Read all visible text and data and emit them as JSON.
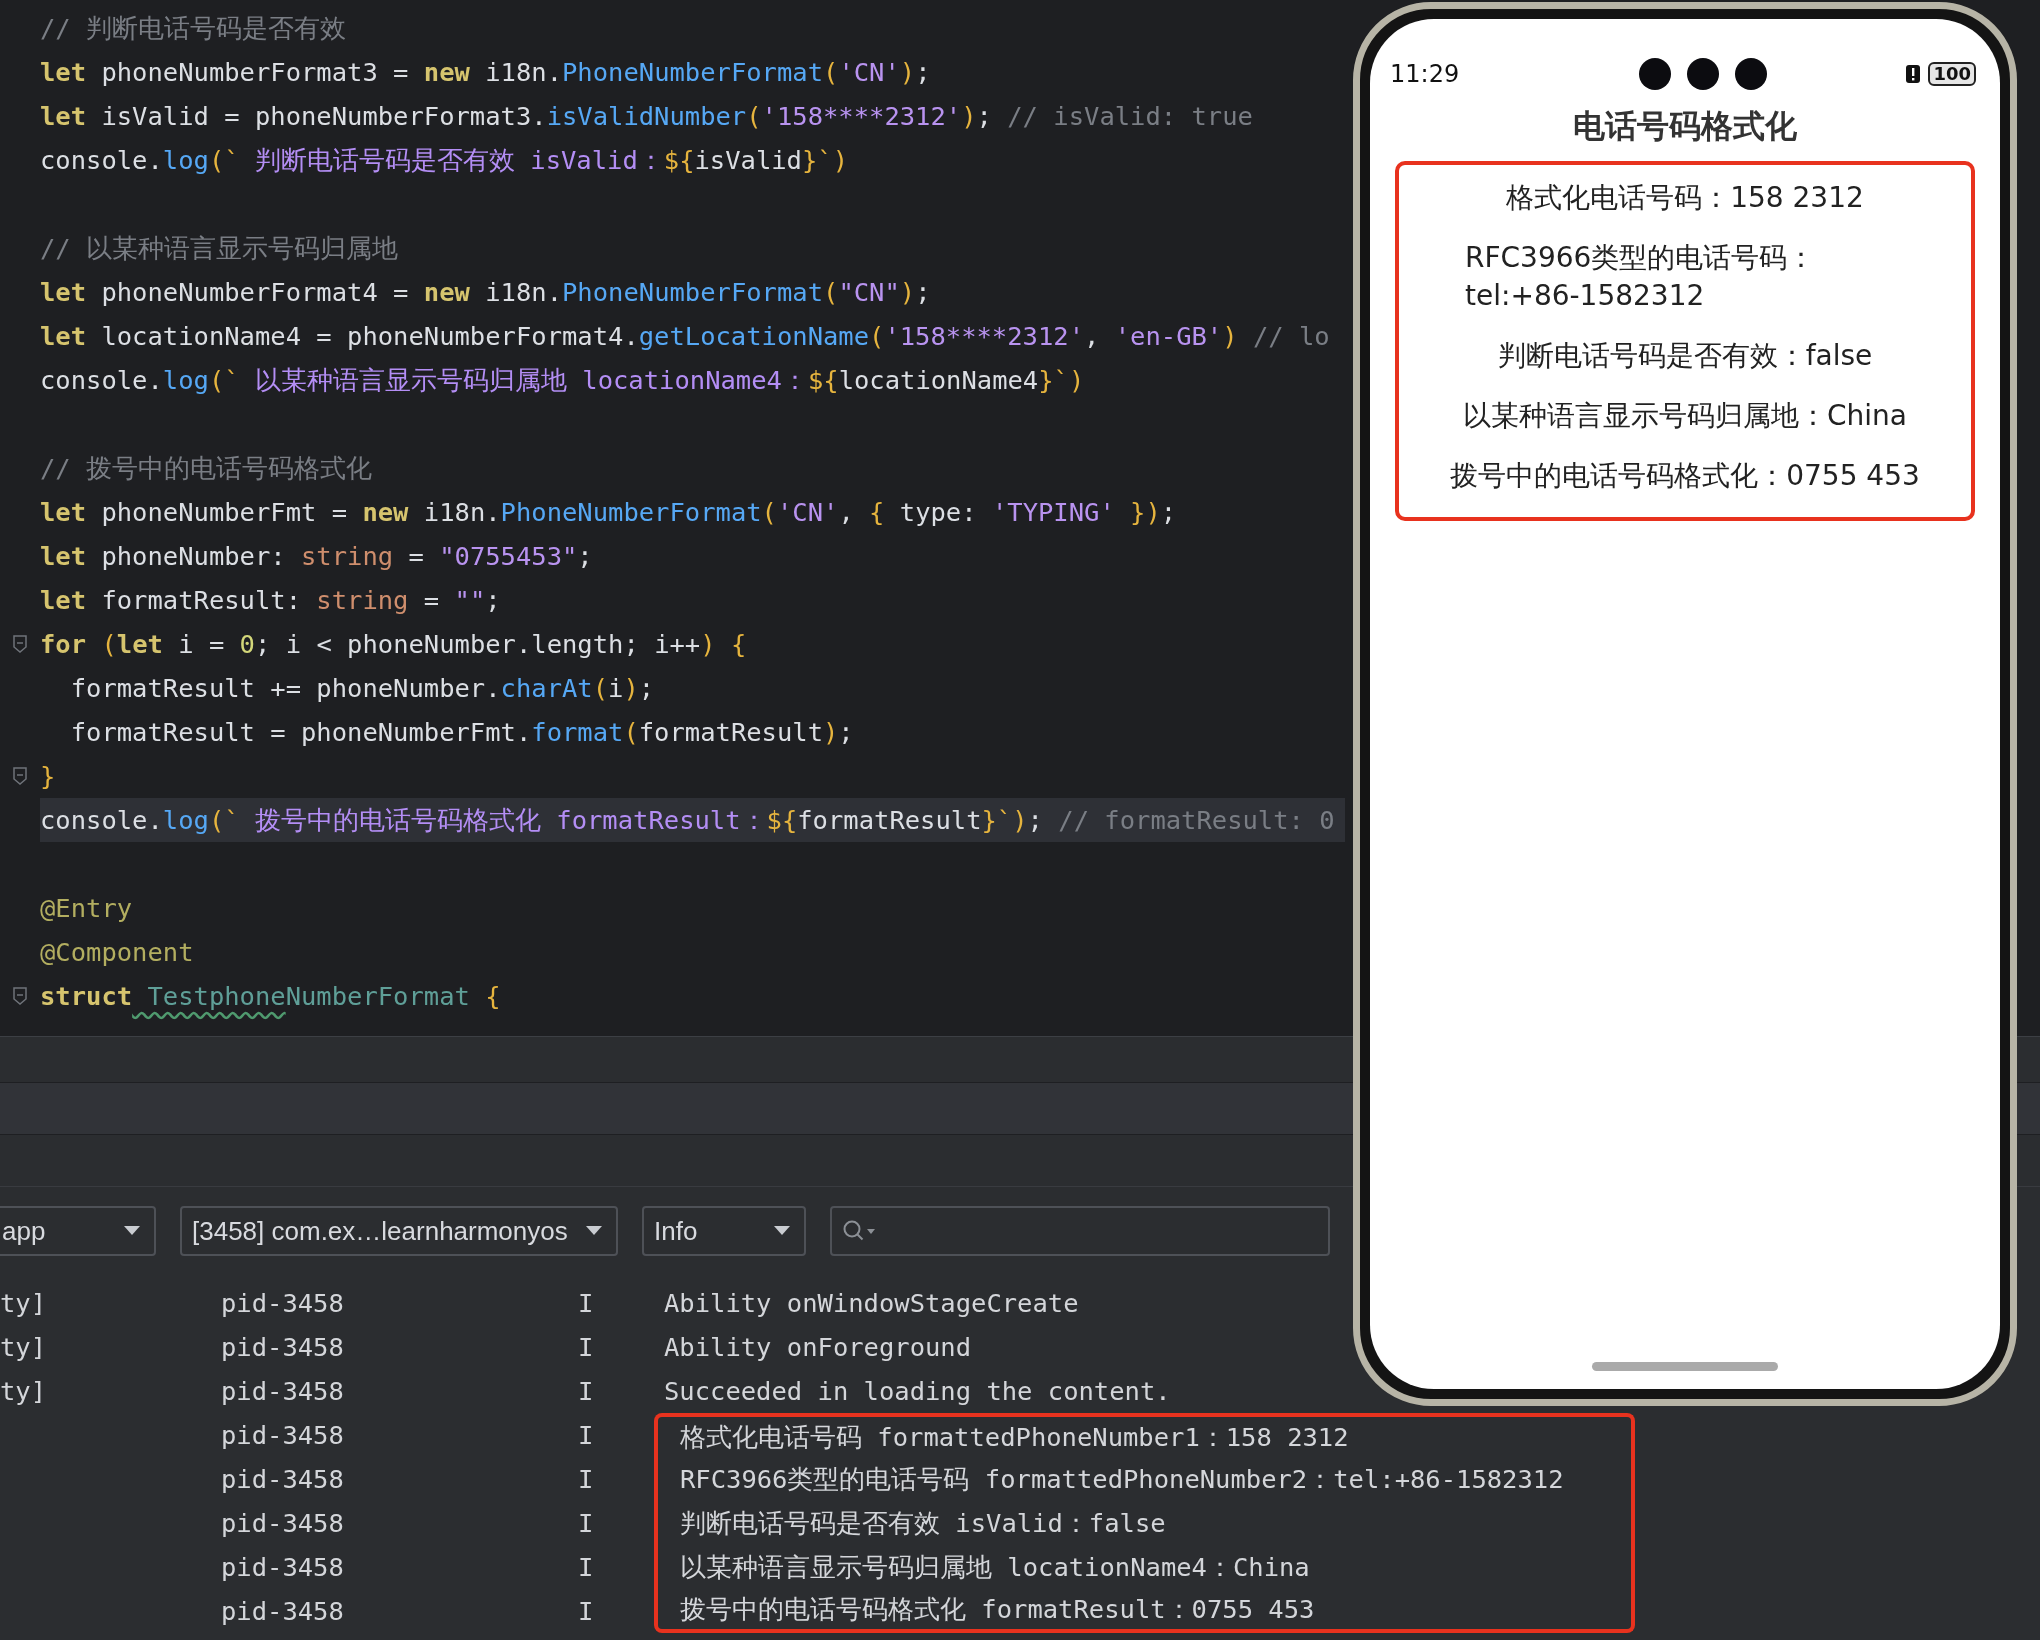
{
  "editor": {
    "blocks": [
      {
        "lines": [
          {
            "fold": false,
            "current": false,
            "tokens": [
              {
                "kind": "cm",
                "text": "// 判断电话号码是否有效"
              }
            ]
          },
          {
            "fold": false,
            "current": false,
            "tokens": [
              {
                "kind": "kw",
                "text": "let"
              },
              {
                "kind": "id",
                "text": " phoneNumberFormat3 = "
              },
              {
                "kind": "kw",
                "text": "new"
              },
              {
                "kind": "id",
                "text": " i18n."
              },
              {
                "kind": "fn",
                "text": "PhoneNumberFormat"
              },
              {
                "kind": "br",
                "text": "("
              },
              {
                "kind": "str",
                "text": "'CN'"
              },
              {
                "kind": "br",
                "text": ")"
              },
              {
                "kind": "id",
                "text": ";"
              }
            ]
          },
          {
            "fold": false,
            "current": false,
            "tokens": [
              {
                "kind": "kw",
                "text": "let"
              },
              {
                "kind": "id",
                "text": " isValid = phoneNumberFormat3."
              },
              {
                "kind": "fn",
                "text": "isValidNumber"
              },
              {
                "kind": "br",
                "text": "("
              },
              {
                "kind": "str",
                "text": "'158****2312'"
              },
              {
                "kind": "br",
                "text": ")"
              },
              {
                "kind": "id",
                "text": "; "
              },
              {
                "kind": "cm",
                "text": "// isValid: true"
              }
            ]
          },
          {
            "fold": false,
            "current": false,
            "tokens": [
              {
                "kind": "id",
                "text": "console."
              },
              {
                "kind": "fn",
                "text": "log"
              },
              {
                "kind": "br",
                "text": "(`"
              },
              {
                "kind": "tpl",
                "text": " 判断电话号码是否有效 isValid："
              },
              {
                "kind": "br",
                "text": "${"
              },
              {
                "kind": "id",
                "text": "isValid"
              },
              {
                "kind": "br",
                "text": "}`)"
              }
            ]
          }
        ]
      },
      {
        "lines": [
          {
            "fold": false,
            "current": false,
            "tokens": [
              {
                "kind": "cm",
                "text": "// 以某种语言显示号码归属地"
              }
            ]
          },
          {
            "fold": false,
            "current": false,
            "tokens": [
              {
                "kind": "kw",
                "text": "let"
              },
              {
                "kind": "id",
                "text": " phoneNumberFormat4 = "
              },
              {
                "kind": "kw",
                "text": "new"
              },
              {
                "kind": "id",
                "text": " i18n."
              },
              {
                "kind": "fn",
                "text": "PhoneNumberFormat"
              },
              {
                "kind": "br",
                "text": "("
              },
              {
                "kind": "str",
                "text": "\"CN\""
              },
              {
                "kind": "br",
                "text": ")"
              },
              {
                "kind": "id",
                "text": ";"
              }
            ]
          },
          {
            "fold": false,
            "current": false,
            "tokens": [
              {
                "kind": "kw",
                "text": "let"
              },
              {
                "kind": "id",
                "text": " locationName4 = phoneNumberFormat4."
              },
              {
                "kind": "fn",
                "text": "getLocationName"
              },
              {
                "kind": "br",
                "text": "("
              },
              {
                "kind": "str",
                "text": "'158****2312'"
              },
              {
                "kind": "id",
                "text": ", "
              },
              {
                "kind": "str",
                "text": "'en-GB'"
              },
              {
                "kind": "br",
                "text": ") "
              },
              {
                "kind": "cm",
                "text": "// lo"
              }
            ]
          },
          {
            "fold": false,
            "current": false,
            "tokens": [
              {
                "kind": "id",
                "text": "console."
              },
              {
                "kind": "fn",
                "text": "log"
              },
              {
                "kind": "br",
                "text": "(`"
              },
              {
                "kind": "tpl",
                "text": " 以某种语言显示号码归属地 locationName4："
              },
              {
                "kind": "br",
                "text": "${"
              },
              {
                "kind": "id",
                "text": "locationName4"
              },
              {
                "kind": "br",
                "text": "}`)"
              }
            ]
          }
        ]
      },
      {
        "lines": [
          {
            "fold": false,
            "current": false,
            "tokens": [
              {
                "kind": "cm",
                "text": "// 拨号中的电话号码格式化"
              }
            ]
          },
          {
            "fold": false,
            "current": false,
            "tokens": [
              {
                "kind": "kw",
                "text": "let"
              },
              {
                "kind": "id",
                "text": " phoneNumberFmt = "
              },
              {
                "kind": "kw",
                "text": "new"
              },
              {
                "kind": "id",
                "text": " i18n."
              },
              {
                "kind": "fn",
                "text": "PhoneNumberFormat"
              },
              {
                "kind": "br",
                "text": "("
              },
              {
                "kind": "str",
                "text": "'CN'"
              },
              {
                "kind": "id",
                "text": ", "
              },
              {
                "kind": "br",
                "text": "{"
              },
              {
                "kind": "id",
                "text": " type: "
              },
              {
                "kind": "str",
                "text": "'TYPING' "
              },
              {
                "kind": "br",
                "text": "})"
              },
              {
                "kind": "id",
                "text": ";"
              }
            ]
          },
          {
            "fold": false,
            "current": false,
            "tokens": [
              {
                "kind": "kw",
                "text": "let"
              },
              {
                "kind": "id",
                "text": " phoneNumber: "
              },
              {
                "kind": "ty",
                "text": "string"
              },
              {
                "kind": "id",
                "text": " = "
              },
              {
                "kind": "str",
                "text": "\"0755453\""
              },
              {
                "kind": "id",
                "text": ";"
              }
            ]
          },
          {
            "fold": false,
            "current": false,
            "tokens": [
              {
                "kind": "kw",
                "text": "let"
              },
              {
                "kind": "id",
                "text": " formatResult: "
              },
              {
                "kind": "ty",
                "text": "string"
              },
              {
                "kind": "id",
                "text": " = "
              },
              {
                "kind": "str",
                "text": "\"\""
              },
              {
                "kind": "id",
                "text": ";"
              }
            ]
          },
          {
            "fold": true,
            "current": false,
            "tokens": [
              {
                "kind": "kw",
                "text": "for"
              },
              {
                "kind": "br",
                "text": " ("
              },
              {
                "kind": "kw",
                "text": "let"
              },
              {
                "kind": "id",
                "text": " i = "
              },
              {
                "kind": "num",
                "text": "0"
              },
              {
                "kind": "id",
                "text": "; i < phoneNumber.length; i++"
              },
              {
                "kind": "br",
                "text": ") {"
              }
            ]
          },
          {
            "fold": false,
            "current": false,
            "tokens": [
              {
                "kind": "id",
                "text": "  formatResult += phoneNumber."
              },
              {
                "kind": "fn",
                "text": "charAt"
              },
              {
                "kind": "br",
                "text": "("
              },
              {
                "kind": "id",
                "text": "i"
              },
              {
                "kind": "br",
                "text": ")"
              },
              {
                "kind": "id",
                "text": ";"
              }
            ]
          },
          {
            "fold": false,
            "current": false,
            "tokens": [
              {
                "kind": "id",
                "text": "  formatResult = phoneNumberFmt."
              },
              {
                "kind": "fn",
                "text": "format"
              },
              {
                "kind": "br",
                "text": "("
              },
              {
                "kind": "id",
                "text": "formatResult"
              },
              {
                "kind": "br",
                "text": ")"
              },
              {
                "kind": "id",
                "text": ";"
              }
            ]
          },
          {
            "fold": true,
            "current": false,
            "tokens": [
              {
                "kind": "br",
                "text": "}"
              }
            ]
          },
          {
            "fold": false,
            "current": true,
            "tokens": [
              {
                "kind": "id",
                "text": "console."
              },
              {
                "kind": "fn",
                "text": "log"
              },
              {
                "kind": "br",
                "text": "(`"
              },
              {
                "kind": "tpl",
                "text": " 拨号中的电话号码格式化 formatResult："
              },
              {
                "kind": "br",
                "text": "${"
              },
              {
                "kind": "id",
                "text": "formatResult"
              },
              {
                "kind": "br",
                "text": "}`)"
              },
              {
                "kind": "id",
                "text": "; "
              },
              {
                "kind": "cm",
                "text": "// formatResult: 0"
              }
            ]
          }
        ]
      },
      {
        "lines": [
          {
            "fold": false,
            "current": false,
            "tokens": [
              {
                "kind": "ann",
                "text": "@Entry"
              }
            ]
          },
          {
            "fold": false,
            "current": false,
            "tokens": [
              {
                "kind": "ann",
                "text": "@Component"
              }
            ]
          },
          {
            "fold": true,
            "current": false,
            "tokens": [
              {
                "kind": "kw",
                "text": "struct"
              },
              {
                "kind": "typo",
                "text": " Testphone"
              },
              {
                "kind": "cls",
                "text": "NumberFormat"
              },
              {
                "kind": "br",
                "text": " {"
              }
            ]
          }
        ]
      }
    ]
  },
  "log_toolbar": {
    "device": "app",
    "process": "[3458] com.ex…learnharmonyos",
    "level": "Info"
  },
  "log": {
    "rows": [
      {
        "tag": "ty]",
        "pid": "pid-3458",
        "level": "I",
        "message": "Ability onWindowStageCreate",
        "marked": false
      },
      {
        "tag": "ty]",
        "pid": "pid-3458",
        "level": "I",
        "message": "Ability onForeground",
        "marked": false
      },
      {
        "tag": "ty]",
        "pid": "pid-3458",
        "level": "I",
        "message": "Succeeded in loading the content.",
        "marked": false
      },
      {
        "pid": "pid-3458",
        "level": "I",
        "message": "格式化电话号码 formattedPhoneNumber1：158 2312",
        "marked": true
      },
      {
        "pid": "pid-3458",
        "level": "I",
        "message": "RFC3966类型的电话号码 formattedPhoneNumber2：tel:+86-1582312",
        "marked": true
      },
      {
        "pid": "pid-3458",
        "level": "I",
        "message": "判断电话号码是否有效 isValid：false",
        "marked": true
      },
      {
        "pid": "pid-3458",
        "level": "I",
        "message": "以某种语言显示号码归属地 locationName4：China",
        "marked": true
      },
      {
        "pid": "pid-3458",
        "level": "I",
        "message": "拨号中的电话号码格式化 formatResult：0755 453",
        "marked": true
      }
    ]
  },
  "phone": {
    "status_bar": {
      "time": "11:29",
      "battery": "100"
    },
    "title": "电话号码格式化",
    "lines": [
      "格式化电话号码：158 2312",
      "RFC3966类型的电话号码：tel:+86-1582312",
      "判断电话号码是否有效：false",
      "以某种语言显示号码归属地：China",
      "拨号中的电话号码格式化：0755 453"
    ]
  }
}
